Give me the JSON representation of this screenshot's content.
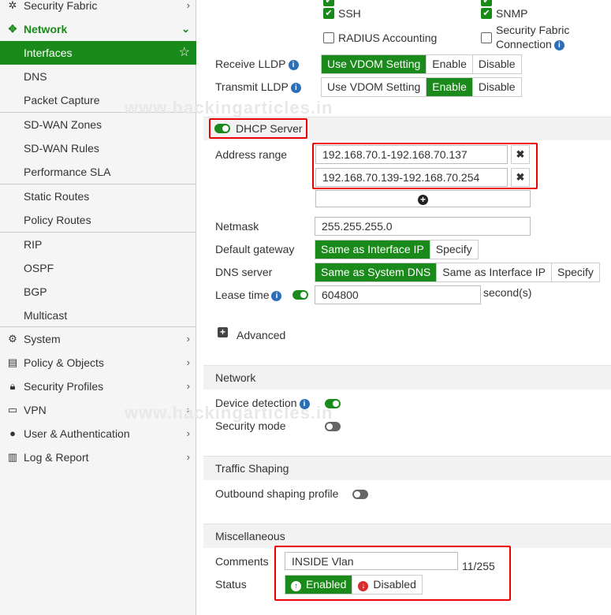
{
  "sidebar": {
    "security_fabric": "Security Fabric",
    "network": "Network",
    "items": [
      {
        "label": "Interfaces"
      },
      {
        "label": "DNS"
      },
      {
        "label": "Packet Capture"
      },
      {
        "label": "SD-WAN Zones"
      },
      {
        "label": "SD-WAN Rules"
      },
      {
        "label": "Performance SLA"
      },
      {
        "label": "Static Routes"
      },
      {
        "label": "Policy Routes"
      },
      {
        "label": "RIP"
      },
      {
        "label": "OSPF"
      },
      {
        "label": "BGP"
      },
      {
        "label": "Multicast"
      }
    ],
    "sections": [
      {
        "label": "System",
        "icon": "gear-icon"
      },
      {
        "label": "Policy & Objects",
        "icon": "policy-icon"
      },
      {
        "label": "Security Profiles",
        "icon": "lock-icon"
      },
      {
        "label": "VPN",
        "icon": "laptop-icon"
      },
      {
        "label": "User & Authentication",
        "icon": "user-icon"
      },
      {
        "label": "Log & Report",
        "icon": "chart-icon"
      }
    ]
  },
  "access": {
    "ssh": "SSH",
    "snmp": "SNMP",
    "radius": "RADIUS Accounting",
    "fabric_line1": "Security Fabric",
    "fabric_line2": "Connection"
  },
  "lldp": {
    "receive_label": "Receive LLDP",
    "transmit_label": "Transmit LLDP",
    "opt_vdom": "Use VDOM Setting",
    "opt_enable": "Enable",
    "opt_disable": "Disable"
  },
  "dhcp": {
    "title": "DHCP Server",
    "address_range_label": "Address range",
    "range1": "192.168.70.1-192.168.70.137",
    "range2": "192.168.70.139-192.168.70.254",
    "netmask_label": "Netmask",
    "netmask": "255.255.255.0",
    "gateway_label": "Default gateway",
    "gw_same": "Same as Interface IP",
    "gw_specify": "Specify",
    "dns_label": "DNS server",
    "dns_same_system": "Same as System DNS",
    "dns_same_iface": "Same as Interface IP",
    "dns_specify": "Specify",
    "lease_label": "Lease time",
    "lease_value": "604800",
    "lease_unit": "second(s)",
    "advanced": "Advanced"
  },
  "network": {
    "title": "Network",
    "device_detection": "Device detection",
    "security_mode": "Security mode"
  },
  "shaping": {
    "title": "Traffic Shaping",
    "outbound": "Outbound shaping profile"
  },
  "misc": {
    "title": "Miscellaneous",
    "comments_label": "Comments",
    "comments_value": "INSIDE Vlan",
    "char_count": "11/255",
    "status_label": "Status",
    "enabled": "Enabled",
    "disabled": "Disabled"
  },
  "watermark": "www.hackingarticles.in",
  "colors": {
    "accent": "#1a8a1a",
    "highlight": "#e00000",
    "info": "#2c6fb7"
  }
}
